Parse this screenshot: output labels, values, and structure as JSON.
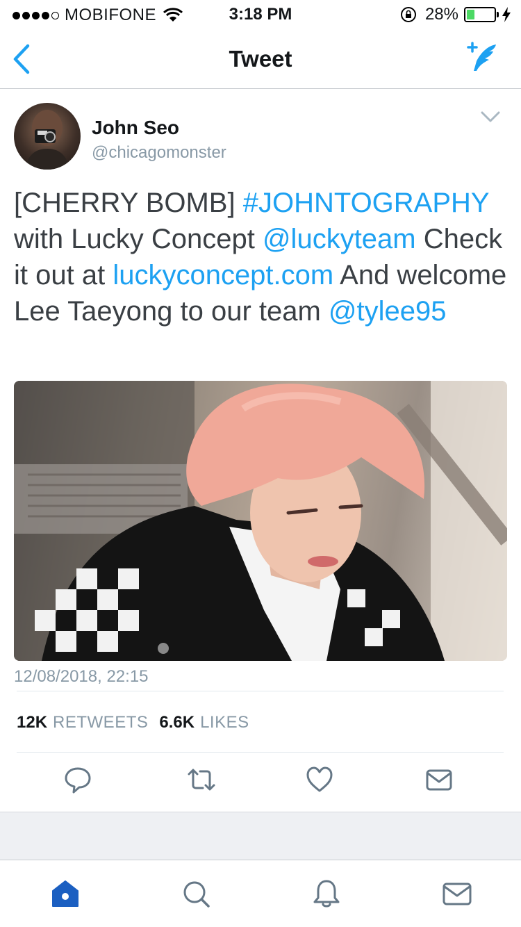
{
  "status_bar": {
    "carrier": "MOBIFONE",
    "time": "3:18 PM",
    "battery_percent": "28%",
    "battery_level": 0.28,
    "battery_color": "#4cd964",
    "signal_bars": 4,
    "icons": [
      "signal-dots-icon",
      "wifi-icon",
      "rotation-lock-icon",
      "battery-icon",
      "charging-bolt-icon"
    ]
  },
  "nav": {
    "title": "Tweet",
    "back_icon": "chevron-left-icon",
    "compose_icon": "compose-feather-icon"
  },
  "tweet": {
    "author_name": "John Seo",
    "author_handle": "@chicagomonster",
    "text_parts": [
      {
        "text": "[CHERRY BOMB] ",
        "link": false
      },
      {
        "text": "#JOHNTOGRAPHY",
        "link": true
      },
      {
        "text": " with Lucky Concept ",
        "link": false
      },
      {
        "text": "@luckyteam",
        "link": true
      },
      {
        "text": " Check it out at ",
        "link": false
      },
      {
        "text": "luckyconcept.com",
        "link": true
      },
      {
        "text": " And welcome Lee Taeyong to our team ",
        "link": false
      },
      {
        "text": "@tylee95",
        "link": true
      }
    ],
    "timestamp": "12/08/2018, 22:15",
    "retweets_count": "12K",
    "retweets_label": "RETWEETS",
    "likes_count": "6.6K",
    "likes_label": "LIKES"
  },
  "actions": [
    "reply-icon",
    "retweet-icon",
    "like-icon",
    "direct-message-icon"
  ],
  "tab_bar": [
    "home-icon",
    "search-icon",
    "notifications-icon",
    "messages-icon"
  ],
  "colors": {
    "accent": "#1da1f2",
    "secondary_text": "#8899a6",
    "body_text": "#3a3f44",
    "tab_active": "#1b5fc1",
    "icon_gray": "#657786"
  }
}
